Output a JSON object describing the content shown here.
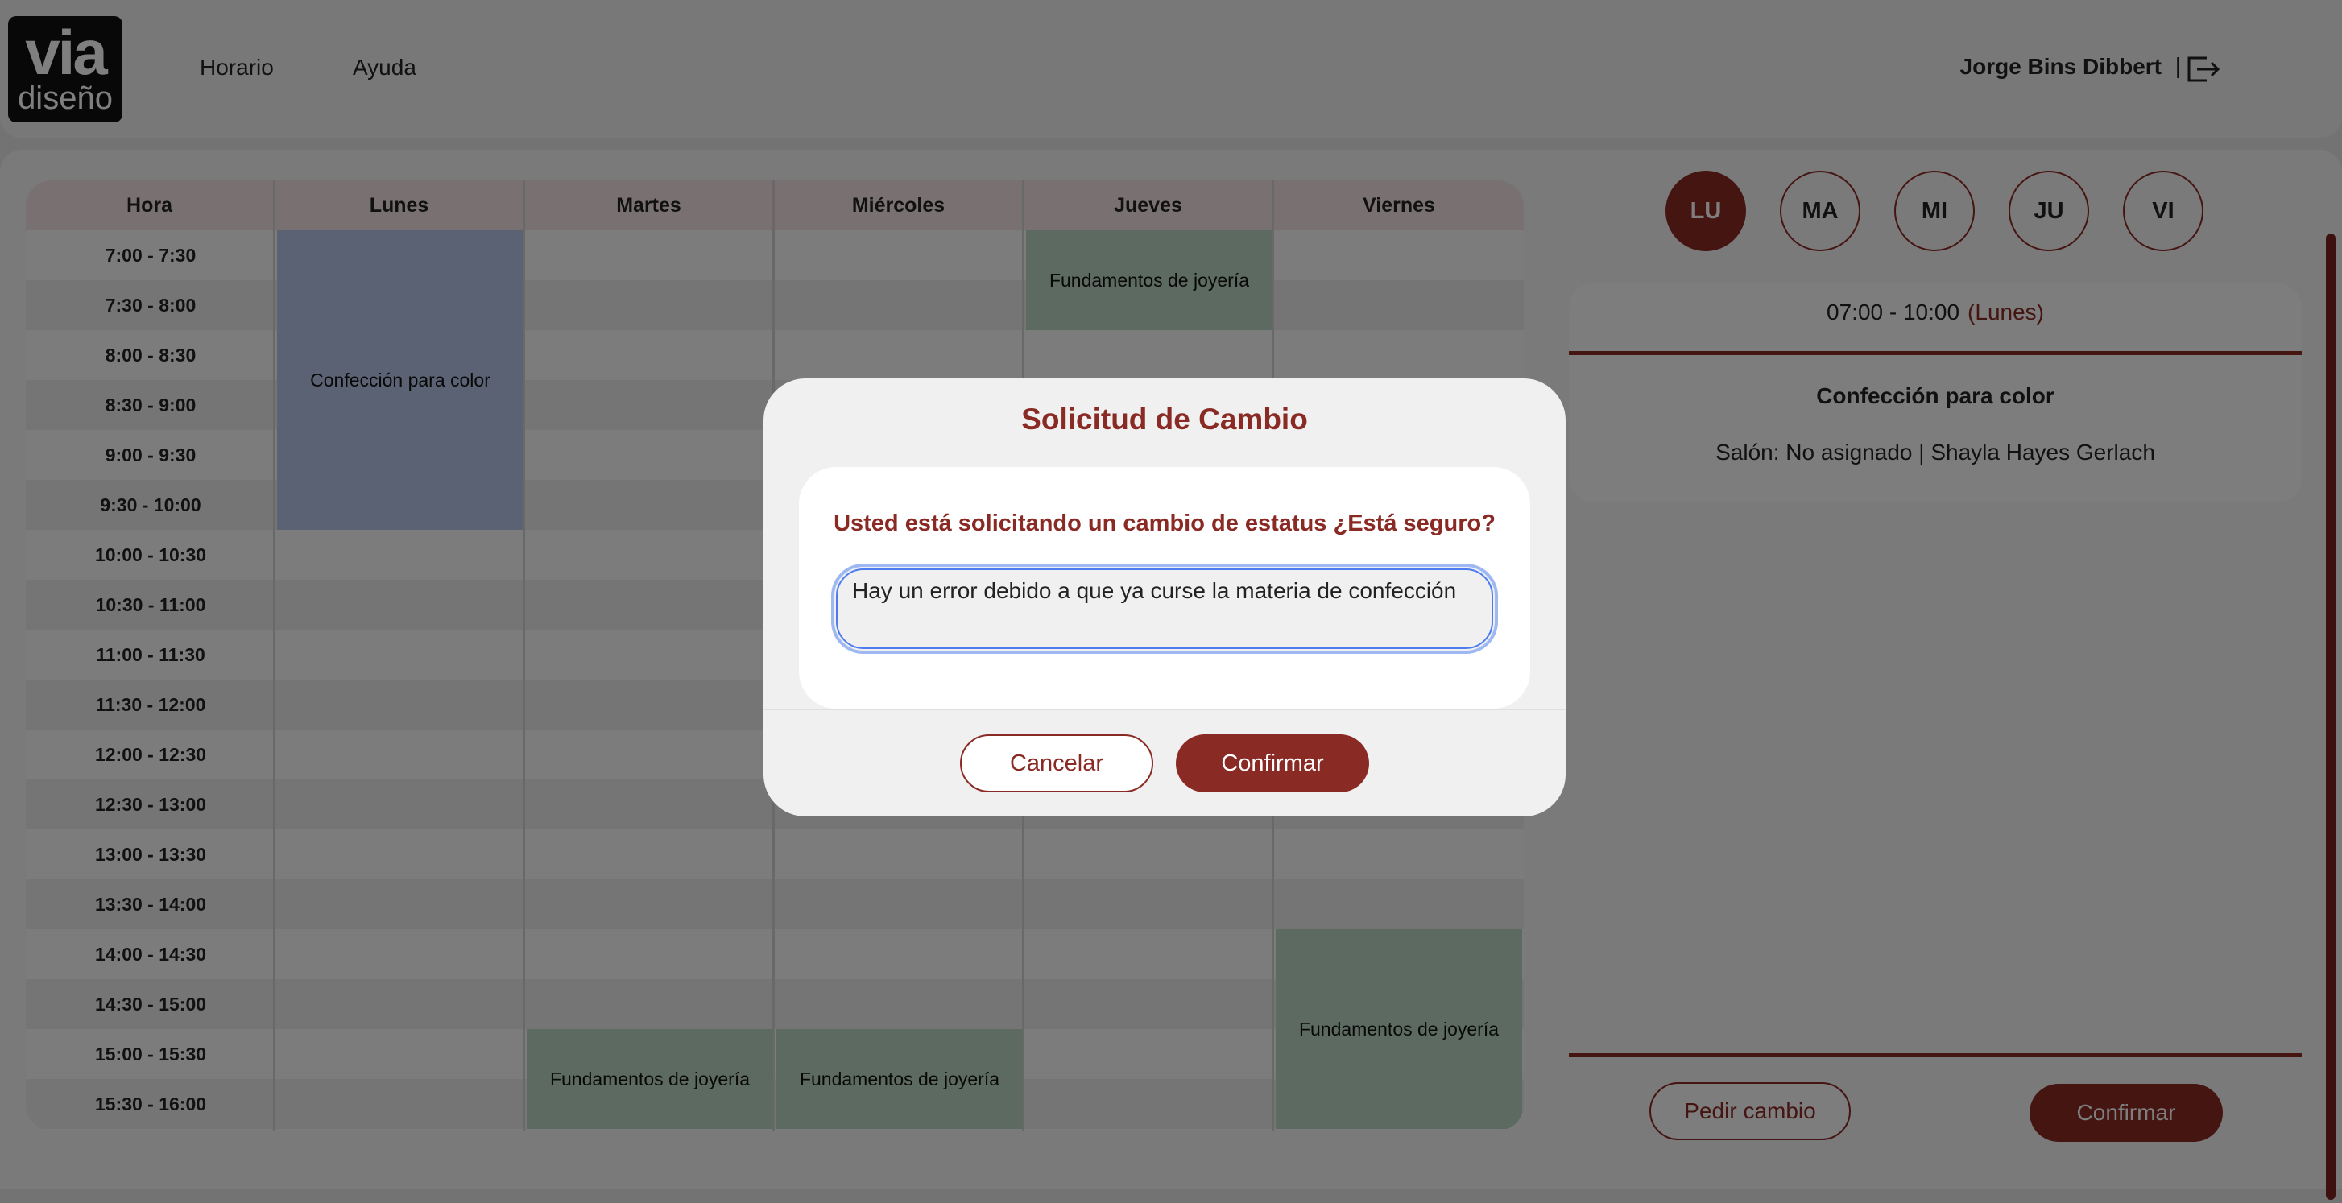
{
  "header": {
    "logo_top": "via",
    "logo_bottom": "diseño",
    "nav": [
      "Horario",
      "Ayuda"
    ],
    "user_name": "Jorge Bins Dibbert",
    "separator": "|"
  },
  "schedule": {
    "columns": [
      "Hora",
      "Lunes",
      "Martes",
      "Miércoles",
      "Jueves",
      "Viernes"
    ],
    "times": [
      "7:00 - 7:30",
      "7:30 - 8:00",
      "8:00 - 8:30",
      "8:30 - 9:00",
      "9:00 - 9:30",
      "9:30 - 10:00",
      "10:00 - 10:30",
      "10:30 - 11:00",
      "11:00 - 11:30",
      "11:30 - 12:00",
      "12:00 - 12:30",
      "12:30 - 13:00",
      "13:00 - 13:30",
      "13:30 - 14:00",
      "14:00 - 14:30",
      "14:30 - 15:00",
      "15:00 - 15:30",
      "15:30 - 16:00"
    ],
    "blocks": [
      {
        "day": 1,
        "start": 0,
        "end": 6,
        "label": "Confección para color",
        "color": "blue"
      },
      {
        "day": 4,
        "start": 0,
        "end": 2,
        "label": "Fundamentos de joyería",
        "color": "green"
      },
      {
        "day": 2,
        "start": 16,
        "end": 18,
        "label": "Fundamentos de joyería",
        "color": "green"
      },
      {
        "day": 3,
        "start": 16,
        "end": 18,
        "label": "Fundamentos de joyería",
        "color": "green"
      },
      {
        "day": 5,
        "start": 14,
        "end": 18,
        "label": "Fundamentos de joyería",
        "color": "green"
      }
    ]
  },
  "days": {
    "items": [
      "LU",
      "MA",
      "MI",
      "JU",
      "VI"
    ],
    "active": "LU"
  },
  "detail": {
    "time_range": "07:00 - 10:00",
    "day": "(Lunes)",
    "course": "Confección para color",
    "room": "Salón: No asignado | Shayla Hayes Gerlach"
  },
  "actions": {
    "request_change": "Pedir cambio",
    "confirm": "Confirmar"
  },
  "modal": {
    "title": "Solicitud de Cambio",
    "question": "Usted está solicitando un cambio de estatus ¿Está seguro?",
    "input_value": "Hay un error debido a que ya curse la materia de confección",
    "cancel": "Cancelar",
    "confirm": "Confirmar"
  },
  "colors": {
    "accent": "#8a2a24",
    "header_row": "#f3e3e2",
    "block_blue": "#b5c5e6",
    "block_green": "#b9d5c2"
  }
}
